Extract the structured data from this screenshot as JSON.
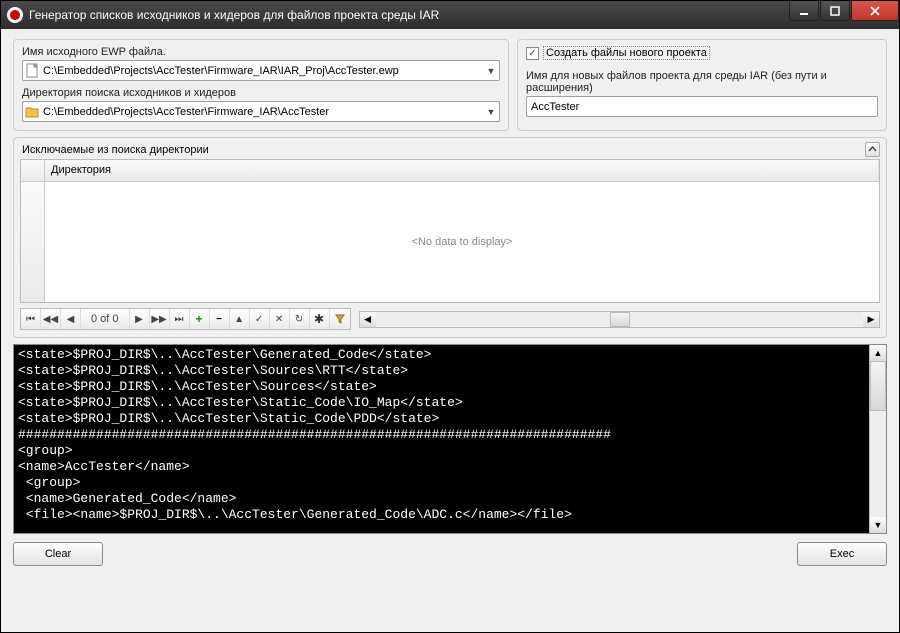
{
  "window": {
    "title": "Генератор списков исходников и хидеров для файлов проекта среды IAR"
  },
  "ewp": {
    "label": "Имя исходного EWP файла.",
    "path": "C:\\Embedded\\Projects\\AccTester\\Firmware_IAR\\IAR_Proj\\AccTester.ewp"
  },
  "searchdir": {
    "label": "Директория поиска исходников и хидеров",
    "path": "C:\\Embedded\\Projects\\AccTester\\Firmware_IAR\\AccTester"
  },
  "createproj": {
    "checkbox_label": "Создать файлы нового проекта",
    "checked": true
  },
  "newname": {
    "label": "Имя для новых файлов проекта для среды IAR (без пути и расширения)",
    "value": "AccTester"
  },
  "excludes": {
    "title": "Исключаемые из поиска директории",
    "col_directory": "Директория",
    "empty": "<No data to display>",
    "nav_counter": "0 of 0"
  },
  "console_lines": [
    "<state>$PROJ_DIR$\\..\\AccTester\\Generated_Code</state>",
    "<state>$PROJ_DIR$\\..\\AccTester\\Sources\\RTT</state>",
    "<state>$PROJ_DIR$\\..\\AccTester\\Sources</state>",
    "<state>$PROJ_DIR$\\..\\AccTester\\Static_Code\\IO_Map</state>",
    "<state>$PROJ_DIR$\\..\\AccTester\\Static_Code\\PDD</state>",
    "############################################################################",
    "<group>",
    "<name>AccTester</name>",
    " <group>",
    " <name>Generated_Code</name>",
    " <file><name>$PROJ_DIR$\\..\\AccTester\\Generated_Code\\ADC.c</name></file>"
  ],
  "buttons": {
    "clear": "Clear",
    "exec": "Exec"
  }
}
